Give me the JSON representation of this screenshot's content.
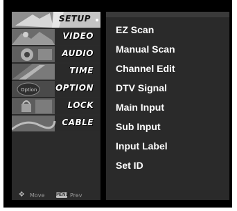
{
  "categories": [
    {
      "label": "SETUP",
      "active": true,
      "color": "#b9b9b9"
    },
    {
      "label": "VIDEO",
      "active": false,
      "color": "#5a5a5a"
    },
    {
      "label": "AUDIO",
      "active": false,
      "color": "#4f4f4f"
    },
    {
      "label": "TIME",
      "active": false,
      "color": "#5b5b5b"
    },
    {
      "label": "OPTION",
      "active": false,
      "color": "#464646"
    },
    {
      "label": "LOCK",
      "active": false,
      "color": "#555555"
    },
    {
      "label": "CABLE",
      "active": false,
      "color": "#5e5e5e"
    }
  ],
  "footer": {
    "move_label": "Move",
    "prev_label": "Prev",
    "prev_icon_text": "MENU"
  },
  "submenu": {
    "items": [
      "EZ Scan",
      "Manual Scan",
      "Channel Edit",
      "DTV Signal",
      "Main Input",
      "Sub Input",
      "Input Label",
      "Set ID"
    ]
  }
}
